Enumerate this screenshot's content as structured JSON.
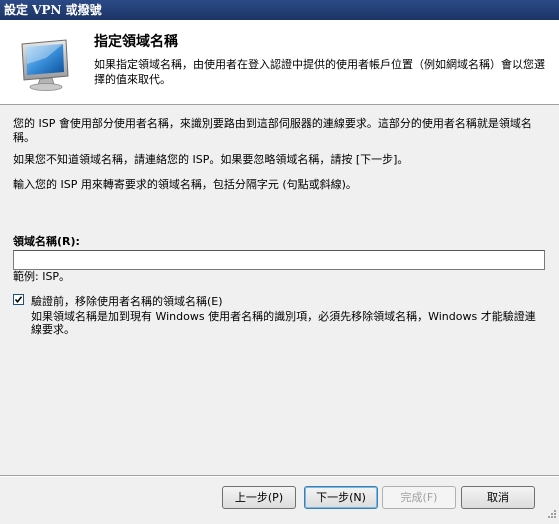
{
  "window": {
    "title": "設定 VPN 或撥號"
  },
  "header": {
    "title": "指定領域名稱",
    "description": "如果指定領域名稱，由使用者在登入認證中提供的使用者帳戶位置（例如網域名稱）會以您選擇的值來取代。"
  },
  "body": {
    "para1": "您的 ISP 會使用部分使用者名稱，來識別要路由到這部伺服器的連線要求。這部分的使用者名稱就是領域名稱。",
    "para2": "如果您不知道領域名稱，請連絡您的 ISP。如果要忽略領域名稱，請按 [下一步]。",
    "para3": "輸入您的 ISP 用來轉寄要求的領域名稱，包括分隔字元 (句點或斜線)。",
    "field_label": "領域名稱(R):",
    "field_value": "",
    "example": "範例: ISP。",
    "checkbox": {
      "checked": true,
      "label": "驗證前，移除使用者名稱的領域名稱(E)",
      "description": "如果領域名稱是加到現有 Windows 使用者名稱的識別項，必須先移除領域名稱，Windows 才能驗證連線要求。"
    }
  },
  "buttons": {
    "back": "上一步(P)",
    "next": "下一步(N)",
    "finish": "完成(F)",
    "cancel": "取消"
  },
  "icons": {
    "header": "monitor-icon",
    "checkmark": "checkmark-icon",
    "grip": "resize-grip-icon"
  }
}
